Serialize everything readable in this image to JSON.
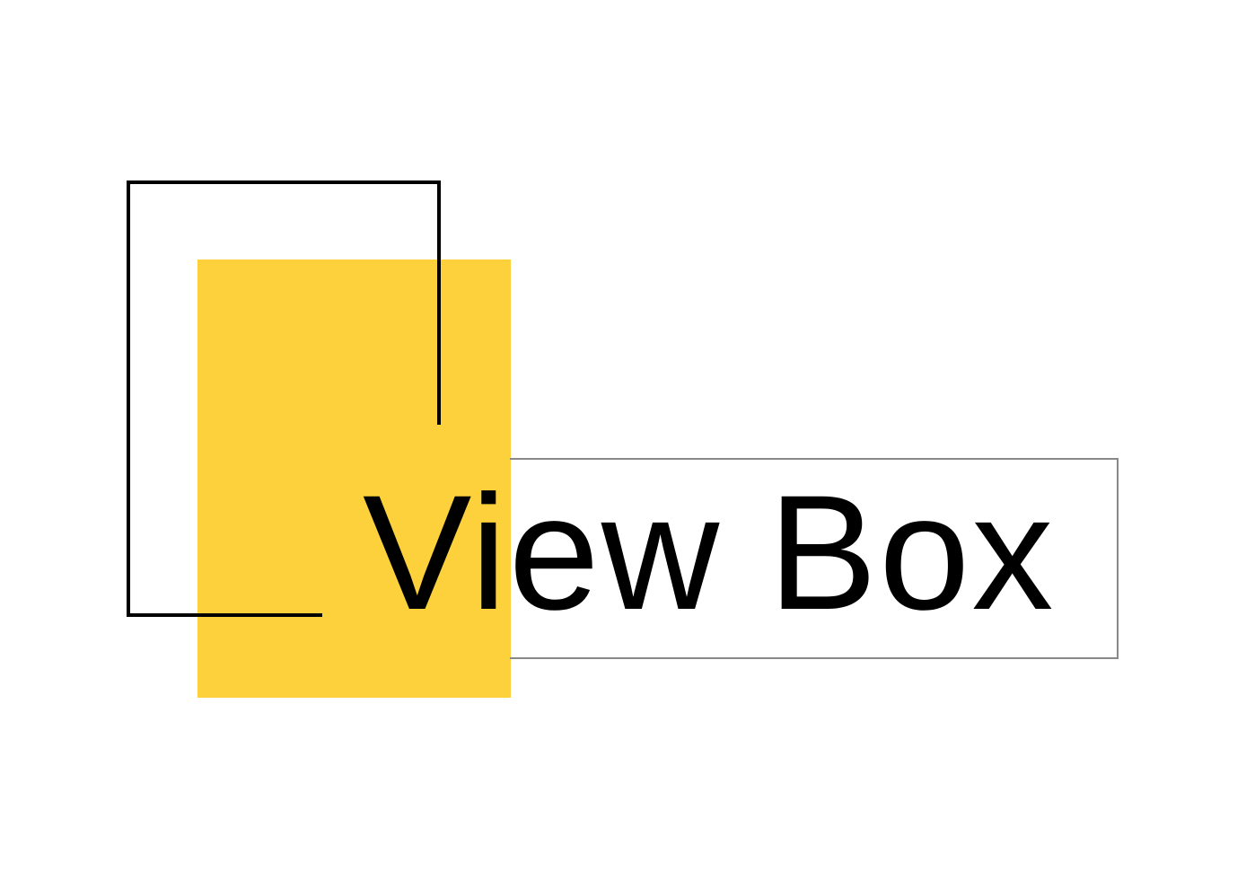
{
  "logo": {
    "wordmark": "View Box",
    "colors": {
      "accent": "#FDD13B",
      "outline": "#000000",
      "frame": "#888888",
      "text": "#000000",
      "background": "#FFFFFF"
    }
  }
}
